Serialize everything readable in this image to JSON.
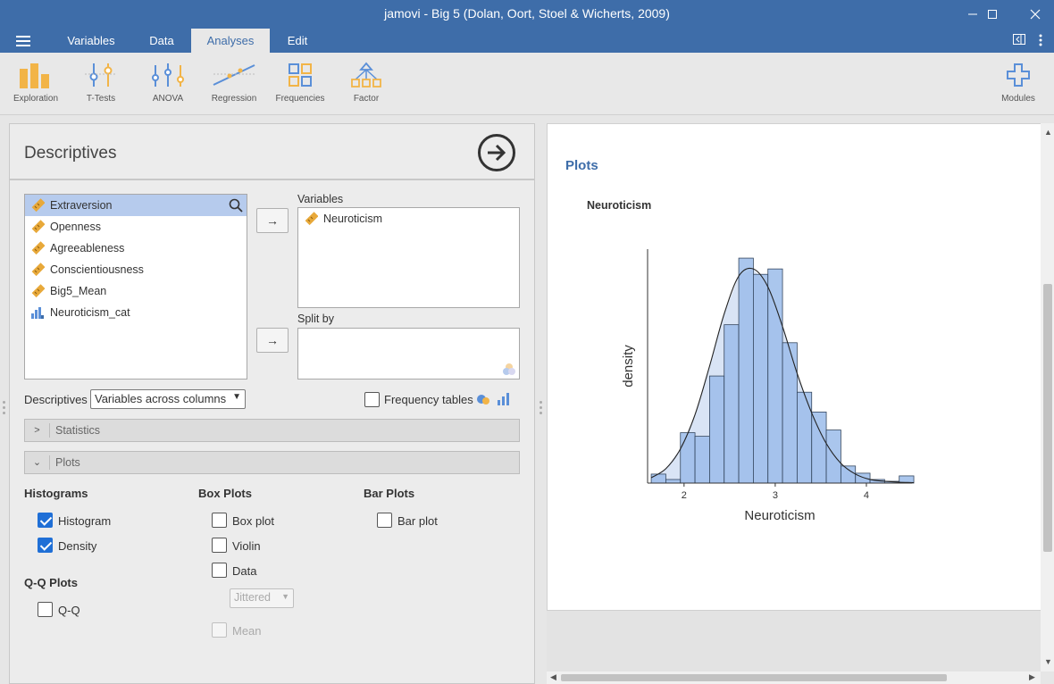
{
  "window": {
    "title": "jamovi - Big 5 (Dolan, Oort, Stoel & Wicherts, 2009)"
  },
  "menu": {
    "tabs": [
      "Variables",
      "Data",
      "Analyses",
      "Edit"
    ],
    "active": "Analyses"
  },
  "ribbon": {
    "tools": [
      "Exploration",
      "T-Tests",
      "ANOVA",
      "Regression",
      "Frequencies",
      "Factor"
    ],
    "modules_label": "Modules"
  },
  "colors": {
    "accent": "#3e6da9",
    "checkbox_blue": "#1f6fd6",
    "histogram_bar": "#9bbcea",
    "selection": "#b6cbed",
    "ruler_icon": "#e8a93a"
  },
  "analysis": {
    "title": "Descriptives",
    "variables_available": [
      {
        "name": "Extraversion",
        "icon": "ruler-icon",
        "selected": true
      },
      {
        "name": "Openness",
        "icon": "ruler-icon"
      },
      {
        "name": "Agreeableness",
        "icon": "ruler-icon"
      },
      {
        "name": "Conscientiousness",
        "icon": "ruler-icon"
      },
      {
        "name": "Big5_Mean",
        "icon": "ruler-icon"
      },
      {
        "name": "Neuroticism_cat",
        "icon": "nominal-bars-icon"
      }
    ],
    "variables_label": "Variables",
    "variables_selected": [
      "Neuroticism"
    ],
    "split_by_label": "Split by",
    "arrow_symbol": "→",
    "descriptives_label": "Descriptives",
    "descriptives_option": "Variables across columns",
    "frequency_tables_label": "Frequency tables",
    "statistics_label": "Statistics",
    "plots_label": "Plots",
    "histograms": {
      "heading": "Histograms",
      "histogram": "Histogram",
      "density": "Density"
    },
    "box_plots": {
      "heading": "Box Plots",
      "box_plot": "Box plot",
      "violin": "Violin",
      "data": "Data",
      "jitter": "Jittered",
      "mean": "Mean"
    },
    "bar_plots": {
      "heading": "Bar Plots",
      "bar_plot": "Bar plot"
    },
    "qq_plots": {
      "heading": "Q-Q Plots",
      "qq": "Q-Q"
    }
  },
  "results": {
    "heading": "Plots",
    "plot_title": "Neuroticism"
  },
  "chart_data": {
    "type": "bar",
    "title": "Neuroticism",
    "xlabel": "Neuroticism",
    "ylabel": "density",
    "xticks": [
      2,
      3,
      4
    ],
    "x_range": [
      1.6,
      4.5
    ],
    "bin_width": 0.16,
    "bin_starts": [
      1.64,
      1.8,
      1.96,
      2.12,
      2.28,
      2.44,
      2.6,
      2.76,
      2.92,
      3.08,
      3.24,
      3.4,
      3.56,
      3.72,
      3.88,
      4.04,
      4.2,
      4.36
    ],
    "values": [
      0.1,
      0.04,
      0.56,
      0.52,
      1.19,
      1.76,
      2.5,
      2.32,
      2.38,
      1.56,
      1.01,
      0.79,
      0.59,
      0.19,
      0.11,
      0.04,
      0.02,
      0.08
    ],
    "density_curve": {
      "x": [
        1.64,
        1.8,
        1.96,
        2.12,
        2.28,
        2.44,
        2.6,
        2.76,
        2.92,
        3.08,
        3.24,
        3.4,
        3.56,
        3.72,
        3.88,
        4.04,
        4.2,
        4.36,
        4.52
      ],
      "y": [
        0.06,
        0.16,
        0.38,
        0.76,
        1.3,
        1.88,
        2.3,
        2.38,
        2.18,
        1.74,
        1.22,
        0.78,
        0.44,
        0.22,
        0.1,
        0.04,
        0.02,
        0.01,
        0.005
      ]
    },
    "ylim": [
      0,
      2.6
    ],
    "grid": false
  }
}
